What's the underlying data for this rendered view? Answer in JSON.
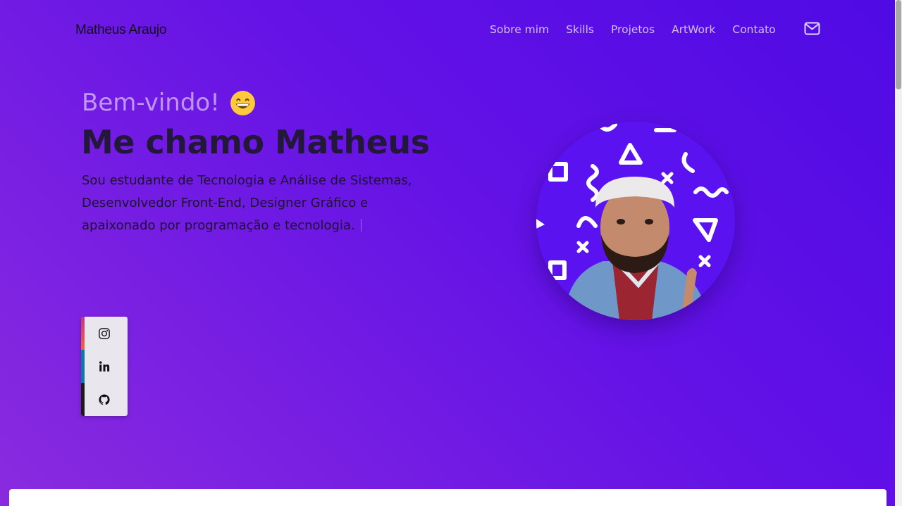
{
  "header": {
    "brand": "Matheus Araujo",
    "nav": [
      "Sobre mim",
      "Skills",
      "Projetos",
      "ArtWork",
      "Contato"
    ],
    "mail_icon": "envelope-icon"
  },
  "hero": {
    "greeting": "Bem-vindo!",
    "greeting_emoji": "grinning-face-emoji",
    "title": "Me chamo Matheus",
    "description": "Sou estudante de Tecnologia e Análise de Sistemas, Desenvolvedor Front-End, Designer Gráfico e apaixonado por programação e tecnologia."
  },
  "social": [
    {
      "name": "instagram",
      "icon": "instagram-icon",
      "color": "#e1306c"
    },
    {
      "name": "linkedin",
      "icon": "linkedin-icon",
      "color": "#0e76a8"
    },
    {
      "name": "github",
      "icon": "github-icon",
      "color": "#1b1b1b"
    }
  ],
  "colors": {
    "background_start": "#4f0ae4",
    "background_end": "#8a2bdf",
    "avatar_bg": "#5b12f0"
  }
}
